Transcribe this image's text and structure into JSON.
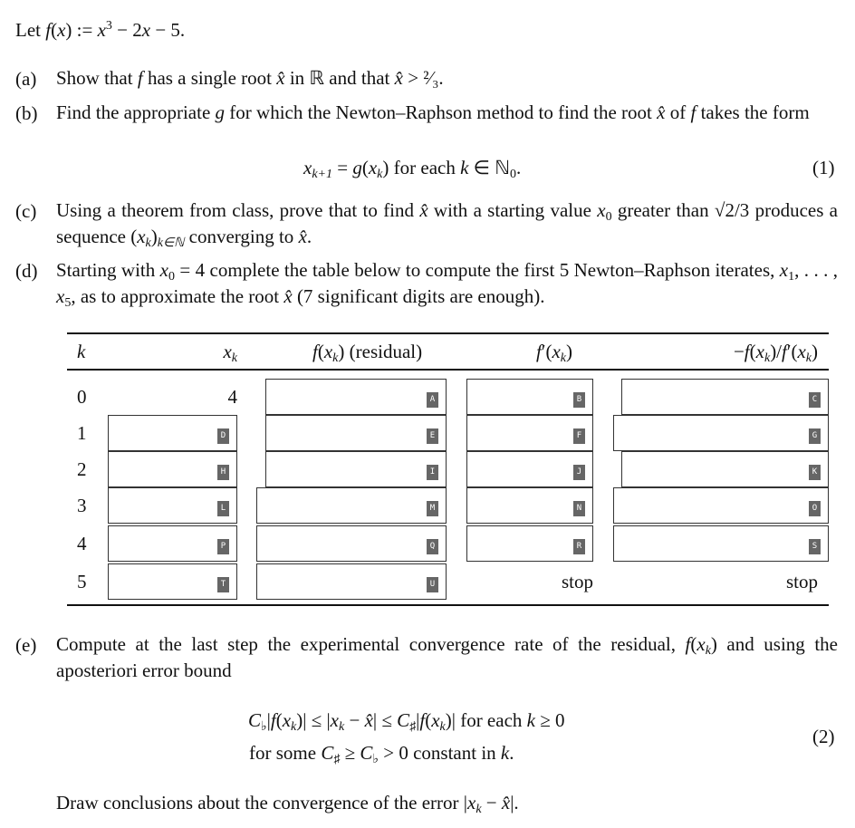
{
  "intro": [
    [
      "Let ",
      ""
    ],
    [
      "f",
      "i"
    ],
    [
      "(",
      ""
    ],
    [
      "x",
      "i"
    ],
    [
      ") := ",
      ""
    ],
    [
      "x",
      "i"
    ],
    [
      "3",
      "p"
    ],
    [
      " − 2",
      ""
    ],
    [
      "x",
      "i"
    ],
    [
      " − 5.",
      ""
    ]
  ],
  "items": {
    "a": {
      "label": "(a)",
      "text": [
        [
          "Show that ",
          ""
        ],
        [
          "f",
          "i"
        ],
        [
          " has a single root ",
          ""
        ],
        [
          "x̂",
          "i"
        ],
        [
          " in ℝ and that ",
          ""
        ],
        [
          "x̂",
          "i"
        ],
        [
          " > ²⁄₃.",
          ""
        ]
      ]
    },
    "b": {
      "label": "(b)",
      "text": [
        [
          "Find the appropriate ",
          ""
        ],
        [
          "g",
          "i"
        ],
        [
          " for which the Newton–Raphson method to find the root ",
          ""
        ],
        [
          "x̂",
          "i"
        ],
        [
          " of ",
          ""
        ],
        [
          "f",
          "i"
        ],
        [
          " takes the form",
          ""
        ]
      ]
    },
    "c": {
      "label": "(c)",
      "text": [
        [
          "Using a theorem from class, prove that to find ",
          ""
        ],
        [
          "x̂",
          "i"
        ],
        [
          " with a starting value ",
          ""
        ],
        [
          "x",
          "i"
        ],
        [
          "0",
          "s"
        ],
        [
          " greater than √",
          ""
        ],
        [
          "2/3",
          ""
        ],
        [
          " produces a sequence (",
          ""
        ],
        [
          "x",
          "i"
        ],
        [
          "k",
          "is"
        ],
        [
          ")",
          ""
        ],
        [
          "k∈ℕ",
          "is"
        ],
        [
          " converging to ",
          ""
        ],
        [
          "x̂",
          "i"
        ],
        [
          ".",
          ""
        ]
      ]
    },
    "d": {
      "label": "(d)",
      "text": [
        [
          "Starting with ",
          ""
        ],
        [
          "x",
          "i"
        ],
        [
          "0",
          "s"
        ],
        [
          " = 4 complete the table below to compute the first 5 Newton–Raphson iterates, ",
          ""
        ],
        [
          "x",
          "i"
        ],
        [
          "1",
          "s"
        ],
        [
          ", . . . , ",
          ""
        ],
        [
          "x",
          "i"
        ],
        [
          "5",
          "s"
        ],
        [
          ", as to approximate the root ",
          ""
        ],
        [
          "x̂",
          "i"
        ],
        [
          " (7 significant digits are enough).",
          ""
        ]
      ]
    },
    "e": {
      "label": "(e)",
      "text": [
        [
          "Compute at the last step the experimental convergence rate of the residual, ",
          ""
        ],
        [
          "f",
          "i"
        ],
        [
          "(",
          ""
        ],
        [
          "x",
          "i"
        ],
        [
          "k",
          "is"
        ],
        [
          ") and using the aposteriori error bound",
          ""
        ]
      ]
    }
  },
  "eq1": {
    "text": [
      [
        "x",
        "i"
      ],
      [
        "k+1",
        "is"
      ],
      [
        " = ",
        ""
      ],
      [
        "g",
        "i"
      ],
      [
        "(",
        ""
      ],
      [
        "x",
        "i"
      ],
      [
        "k",
        "is"
      ],
      [
        ") for each ",
        ""
      ],
      [
        "k",
        "i"
      ],
      [
        " ∈ ℕ",
        ""
      ],
      [
        "0",
        "s"
      ],
      [
        ".",
        ""
      ]
    ],
    "number": "(1)"
  },
  "eq2": {
    "line1": [
      [
        "C",
        "i"
      ],
      [
        "♭",
        "s"
      ],
      [
        "|",
        ""
      ],
      [
        "f",
        "i"
      ],
      [
        "(",
        ""
      ],
      [
        "x",
        "i"
      ],
      [
        "k",
        "is"
      ],
      [
        ")| ≤ |",
        ""
      ],
      [
        "x",
        "i"
      ],
      [
        "k",
        "is"
      ],
      [
        " − ",
        ""
      ],
      [
        "x̂",
        "i"
      ],
      [
        "| ≤ ",
        ""
      ],
      [
        "C",
        "i"
      ],
      [
        "♯",
        "s"
      ],
      [
        "|",
        ""
      ],
      [
        "f",
        "i"
      ],
      [
        "(",
        ""
      ],
      [
        "x",
        "i"
      ],
      [
        "k",
        "is"
      ],
      [
        ")| for each ",
        ""
      ],
      [
        "k",
        "i"
      ],
      [
        " ≥ 0",
        ""
      ]
    ],
    "line2": [
      [
        "for some ",
        ""
      ],
      [
        "C",
        "i"
      ],
      [
        "♯",
        "s"
      ],
      [
        " ≥ ",
        ""
      ],
      [
        "C",
        "i"
      ],
      [
        "♭",
        "s"
      ],
      [
        " > 0 constant in ",
        ""
      ],
      [
        "k",
        "i"
      ],
      [
        ".",
        ""
      ]
    ],
    "number": "(2)"
  },
  "conclusion": [
    [
      "Draw conclusions about the convergence of the error |",
      ""
    ],
    [
      "x",
      "i"
    ],
    [
      "k",
      "is"
    ],
    [
      " − ",
      ""
    ],
    [
      "x̂",
      "i"
    ],
    [
      "|.",
      ""
    ]
  ],
  "table": {
    "headers": {
      "k": [
        [
          "k",
          "i"
        ]
      ],
      "xk": [
        [
          "x",
          "i"
        ],
        [
          "k",
          "is"
        ]
      ],
      "residual": [
        [
          "f",
          "i"
        ],
        [
          "(",
          ""
        ],
        [
          "x",
          "i"
        ],
        [
          "k",
          "is"
        ],
        [
          ") (residual)",
          ""
        ]
      ],
      "deriv": [
        [
          "f",
          "i"
        ],
        [
          "′(",
          ""
        ],
        [
          "x",
          "i"
        ],
        [
          "k",
          "is"
        ],
        [
          ")",
          ""
        ]
      ],
      "step": [
        [
          "−",
          ""
        ],
        [
          "f",
          "i"
        ],
        [
          "(",
          ""
        ],
        [
          "x",
          "i"
        ],
        [
          "k",
          "is"
        ],
        [
          ")/",
          ""
        ],
        [
          "f",
          "i"
        ],
        [
          "′(",
          ""
        ],
        [
          "x",
          "i"
        ],
        [
          "k",
          "is"
        ],
        [
          ")",
          ""
        ]
      ]
    },
    "rows": [
      {
        "k": "0",
        "xk": "4",
        "residual": "A",
        "deriv": "B",
        "step": "C"
      },
      {
        "k": "1",
        "xk": "D",
        "residual": "E",
        "deriv": "F",
        "step": "G"
      },
      {
        "k": "2",
        "xk": "H",
        "residual": "I",
        "deriv": "J",
        "step": "K"
      },
      {
        "k": "3",
        "xk": "L",
        "residual": "M",
        "deriv": "N",
        "step": "O"
      },
      {
        "k": "4",
        "xk": "P",
        "residual": "Q",
        "deriv": "R",
        "step": "S"
      },
      {
        "k": "5",
        "xk": "T",
        "residual": "U",
        "deriv": "stop",
        "step": "stop"
      }
    ]
  }
}
